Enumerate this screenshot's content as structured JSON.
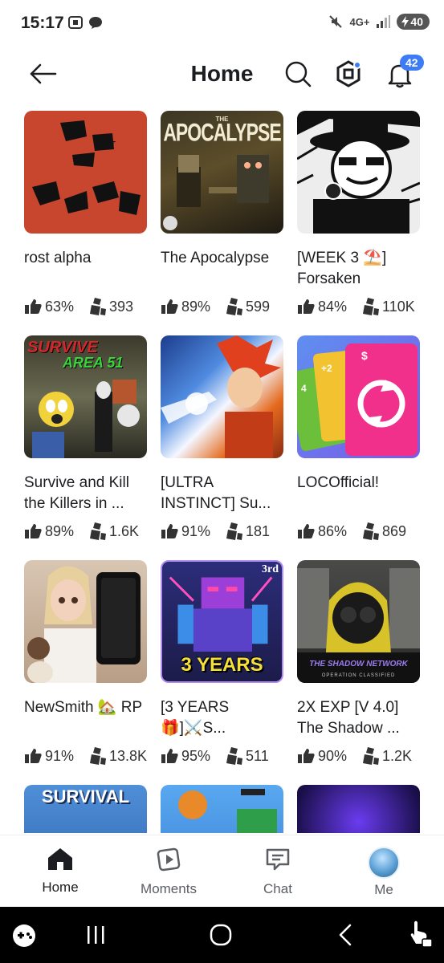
{
  "status_bar": {
    "time": "15:17",
    "network": "4G+",
    "battery": "40"
  },
  "header": {
    "title": "Home",
    "notification_count": "42"
  },
  "games": [
    {
      "title": "rost alpha",
      "rating": "63%",
      "players": "393"
    },
    {
      "title": "The Apocalypse",
      "rating": "89%",
      "players": "599"
    },
    {
      "title": "[WEEK 3 ⛱️] Forsaken",
      "rating": "84%",
      "players": "110K"
    },
    {
      "title": "Survive and Kill the Killers in ...",
      "rating": "89%",
      "players": "1.6K"
    },
    {
      "title": "[ULTRA INSTINCT] Su...",
      "rating": "91%",
      "players": "181"
    },
    {
      "title": "LOCOfficial!",
      "rating": "86%",
      "players": "869"
    },
    {
      "title": "NewSmith 🏡 RP",
      "rating": "91%",
      "players": "13.8K"
    },
    {
      "title": "[3 YEARS🎁]⚔️S...",
      "rating": "95%",
      "players": "511"
    },
    {
      "title": "2X EXP [V 4.0] The Shadow ...",
      "rating": "90%",
      "players": "1.2K"
    }
  ],
  "thumb_text": {
    "apocalypse_top": "THE",
    "apocalypse": "APOCALYPSE",
    "survive": "SURVIVE",
    "area51": "AREA 51",
    "three_years": "3 YEARS",
    "third": "3rd",
    "shadow_network": "THE SHADOW NETWORK",
    "classified": "OPERATION CLASSIFIED",
    "survival": "SURVIVAL"
  },
  "bottom_nav": {
    "home": "Home",
    "moments": "Moments",
    "chat": "Chat",
    "me": "Me"
  },
  "colors": {
    "accent_blue": "#3d7cf5",
    "text_primary": "#1b1d20"
  }
}
